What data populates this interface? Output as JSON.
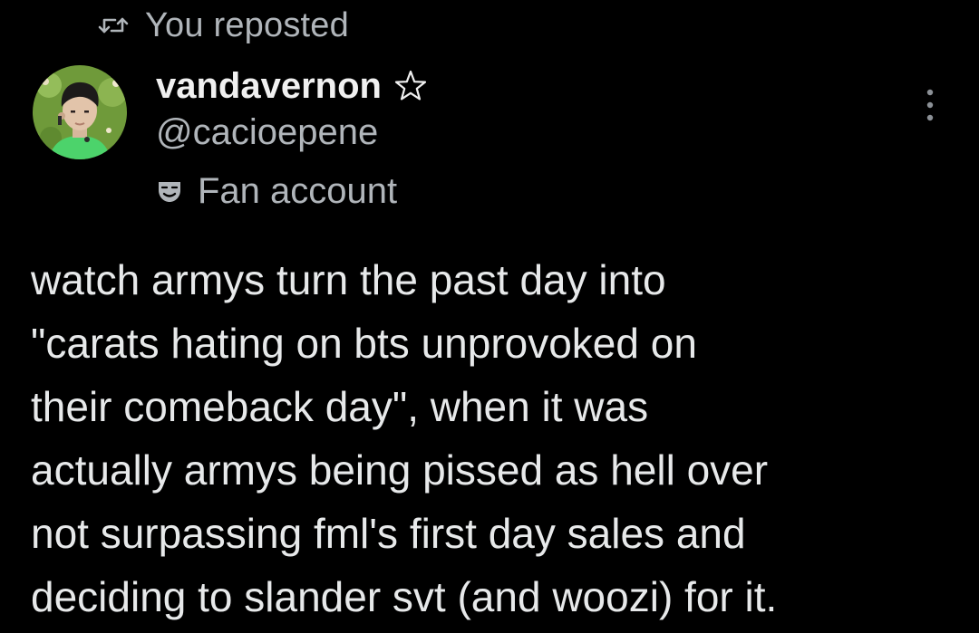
{
  "repost": {
    "icon": "repost-icon",
    "text": "You reposted"
  },
  "author": {
    "avatar_icon": "avatar-photo",
    "display_name": "vandavernon",
    "name_badge_icon": "star-outline-icon",
    "handle": "@cacioepene",
    "label_icon": "theater-mask-icon",
    "label": "Fan account"
  },
  "menu": {
    "icon": "more-vertical-icon"
  },
  "tweet": {
    "lines": [
      "watch armys turn the past day into",
      "\"carats hating on bts unprovoked on",
      "their comeback day\", when it was",
      "actually armys being pissed as hell over",
      "not surpassing fml's first day sales and",
      "deciding to slander svt (and woozi) for it."
    ]
  },
  "colors": {
    "background": "#000000",
    "primary_text": "#e7e9ea",
    "secondary_text": "#b0b5ba"
  }
}
